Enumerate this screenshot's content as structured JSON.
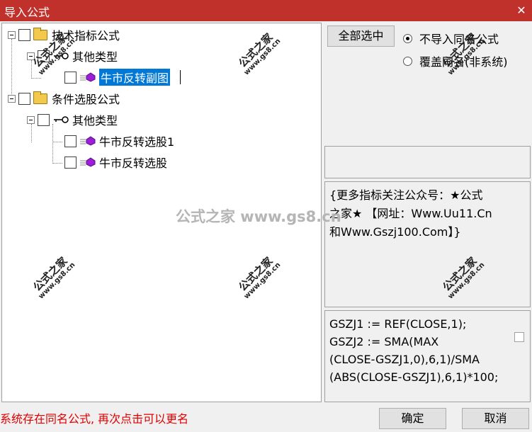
{
  "window": {
    "title": "导入公式",
    "close_glyph": "✕"
  },
  "tree": {
    "items": [
      {
        "label": "技术指标公式",
        "icon": "folder-icon"
      },
      {
        "label": "其他类型",
        "icon": "key-icon"
      },
      {
        "label": "牛市反转副图",
        "icon": "gem-icon",
        "selected": true
      },
      {
        "label": "条件选股公式",
        "icon": "folder-icon"
      },
      {
        "label": "其他类型",
        "icon": "key-icon"
      },
      {
        "label": "牛市反转选股1",
        "icon": "gem-icon"
      },
      {
        "label": "牛市反转选股",
        "icon": "gem-icon"
      }
    ]
  },
  "options": {
    "select_all_label": "全部选中",
    "radio_skip_label": "不导入同名公式",
    "radio_overwrite_label": "覆盖同名(非系统)",
    "selected_radio": "skip"
  },
  "description": {
    "line1": "{更多指标关注公众号：★公式",
    "line2": "之家★ 【网址：Www.Uu11.Cn",
    "line3": "和Www.Gszj100.Com】}"
  },
  "code": {
    "line1": "GSZJ1 := REF(CLOSE,1);",
    "line2": "GSZJ2 := SMA(MAX",
    "line3": "(CLOSE-GSZJ1,0),6,1)/SMA",
    "line4": "(ABS(CLOSE-GSZJ1),6,1)*100;"
  },
  "status_message": "系统存在同名公式, 再次点击可以更名",
  "buttons": {
    "ok": "确定",
    "cancel": "取消"
  },
  "watermark": {
    "text_cn": "公式之家",
    "text_url": "www.gs8.cn",
    "center_text": "公式之家 www.gs8.cn"
  },
  "colors": {
    "title_bar": "#c0312b",
    "selection": "#0078d7",
    "status_text": "#e00000",
    "gem": "#9b1fd6"
  }
}
